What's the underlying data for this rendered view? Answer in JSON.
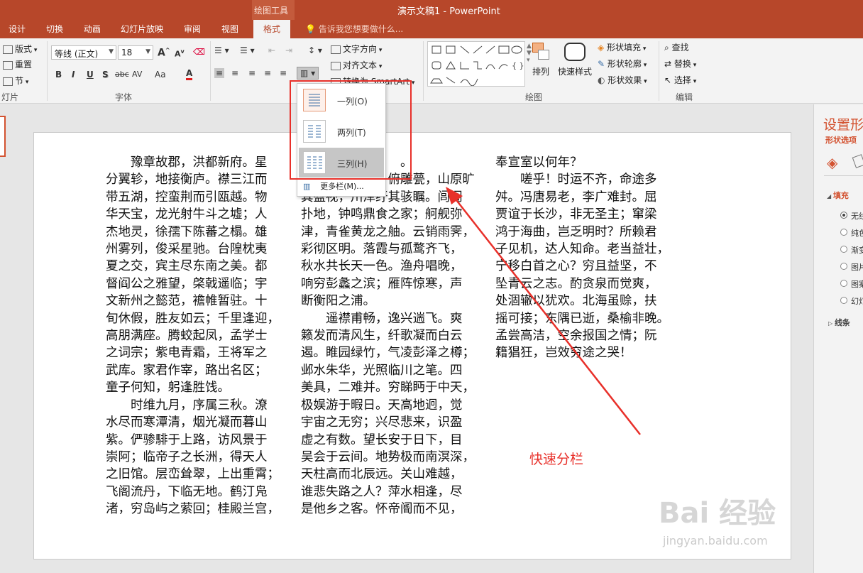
{
  "titlebar": {
    "context_label": "绘图工具",
    "title": "演示文稿1 - PowerPoint"
  },
  "tabs": [
    "设计",
    "切换",
    "动画",
    "幻灯片放映",
    "审阅",
    "视图",
    "格式"
  ],
  "active_tab": "格式",
  "tell_me": "告诉我您想要做什么...",
  "ribbon": {
    "slides_group": {
      "layout": "版式",
      "reset": "重置",
      "section": "节",
      "label": "灯片"
    },
    "font_group": {
      "font_name": "等线 (正文)",
      "font_size": "18",
      "bold": "B",
      "italic": "I",
      "underline": "U",
      "shadow": "S",
      "strike": "abc",
      "spacing": "AV",
      "case": "Aa",
      "color": "A",
      "grow": "A",
      "shrink": "A",
      "label": "字体"
    },
    "paragraph_group": {
      "text_direction": "文字方向",
      "align_text": "对齐文本",
      "smartart": "转换为 SmartArt"
    },
    "drawing_group": {
      "arrange": "排列",
      "quick_styles": "快速样式",
      "shape_fill": "形状填充",
      "shape_outline": "形状轮廓",
      "shape_effects": "形状效果",
      "label": "绘图"
    },
    "editing_group": {
      "find": "查找",
      "replace": "替换",
      "select": "选择",
      "label": "编辑"
    }
  },
  "columns_dropdown": {
    "items": [
      "一列(O)",
      "两列(T)",
      "三列(H)"
    ],
    "more": "更多栏(M)..."
  },
  "slide_text": {
    "col1": [
      "　　豫章故郡，洪都新府。星",
      "分翼轸，地接衡庐。襟三江而",
      "带五湖，控蛮荆而引瓯越。物",
      "华天宝，龙光射牛斗之墟；人",
      "杰地灵，徐孺下陈蕃之榻。雄",
      "州雾列，俊采星驰。台隍枕夷",
      "夏之交，宾主尽东南之美。都",
      "督阎公之雅望，棨戟遥临；宇",
      "文新州之懿范，襜帷暂驻。十",
      "旬休假，胜友如云；千里逢迎，",
      "高朋满座。腾蛟起凤，孟学士",
      "之词宗；紫电青霜，王将军之",
      "武库。家君作宰，路出名区；",
      "童子何知，躬逢胜饯。",
      "　　时维九月，序属三秋。潦",
      "水尽而寒潭清，烟光凝而暮山",
      "紫。俨骖騑于上路，访风景于",
      "崇阿；临帝子之长洲，得天人",
      "之旧馆。层峦耸翠，上出重霄；",
      "飞阁流丹，下临无地。鹤汀凫",
      "渚，穷岛屿之萦回；桂殿兰宫，"
    ],
    "col2": [
      "　　　　　　　　。",
      "　　　　　　　俯雕甍，山原旷",
      "其盈视，川泽纡其骇瞩。闾阎",
      "扑地，钟鸣鼎食之家；舸舰弥",
      "津，青雀黄龙之舳。云销雨霁，",
      "彩彻区明。落霞与孤鹜齐飞，",
      "秋水共长天一色。渔舟唱晚，",
      "响穷彭蠡之滨；雁阵惊寒，声",
      "断衡阳之浦。",
      "　　遥襟甫畅，逸兴遄飞。爽",
      "籁发而清风生，纤歌凝而白云",
      "遏。睢园绿竹，气凌彭泽之樽；",
      "邺水朱华，光照临川之笔。四",
      "美具，二难并。穷睇眄于中天，",
      "极娱游于暇日。天高地迥，觉",
      "宇宙之无穷；兴尽悲来，识盈",
      "虚之有数。望长安于日下，目",
      "吴会于云间。地势极而南溟深，",
      "天柱高而北辰远。关山难越，",
      "谁悲失路之人？萍水相逢，尽",
      "是他乡之客。怀帝阍而不见，"
    ],
    "col3": [
      "奉宣室以何年？",
      "　　嗟乎！时运不齐，命途多",
      "舛。冯唐易老，李广难封。屈",
      "贾谊于长沙，非无圣主；窜梁",
      "鸿于海曲，岂乏明时？所赖君",
      "子见机，达人知命。老当益壮，",
      "宁移白首之心？穷且益坚，不",
      "坠青云之志。酌贪泉而觉爽，",
      "处涸辙以犹欢。北海虽赊，扶",
      "摇可接；东隅已逝，桑榆非晚。",
      "孟尝高洁，空余报国之情；阮",
      "籍猖狂，岂效穷途之哭！"
    ]
  },
  "format_pane": {
    "title": "设置形",
    "subtitle": "形状选项",
    "fill_section": "填充",
    "fill_options": [
      "无线",
      "纯色",
      "渐变",
      "图片",
      "图案",
      "幻灯"
    ],
    "line_section": "线条"
  },
  "annotation": "快速分栏",
  "watermark": {
    "logo": "Bai 经验",
    "url": "jingyan.baidu.com"
  },
  "colors": {
    "brand": "#b7472a",
    "accent": "#d35230",
    "annotation": "#e8302a"
  }
}
